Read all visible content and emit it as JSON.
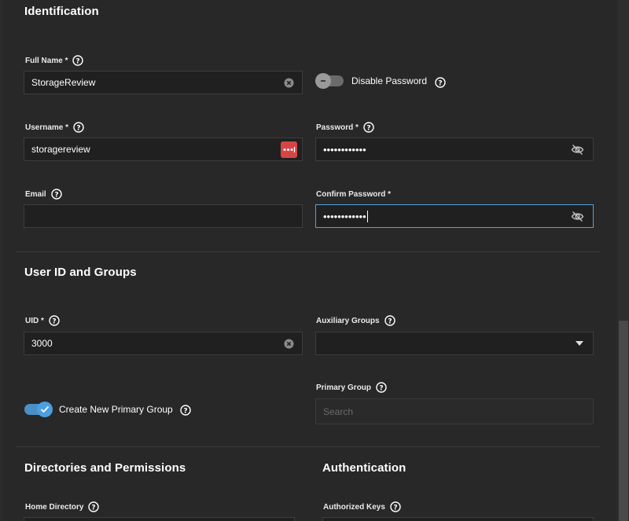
{
  "identification": {
    "title": "Identification",
    "full_name": {
      "label": "Full Name *",
      "value": "StorageReview"
    },
    "disable_password": {
      "label": "Disable Password",
      "checked": false
    },
    "username": {
      "label": "Username *",
      "value": "storagereview"
    },
    "password": {
      "label": "Password *",
      "masked": "••••••••••••"
    },
    "email": {
      "label": "Email",
      "value": ""
    },
    "confirm_password": {
      "label": "Confirm Password *",
      "masked": "••••••••••••"
    }
  },
  "user_id_groups": {
    "title": "User ID and Groups",
    "uid": {
      "label": "UID *",
      "value": "3000"
    },
    "auxiliary_groups": {
      "label": "Auxiliary Groups",
      "value": ""
    },
    "create_primary_group": {
      "label": "Create New Primary Group",
      "checked": true
    },
    "primary_group": {
      "label": "Primary Group",
      "placeholder": "Search"
    }
  },
  "directories": {
    "title": "Directories and Permissions",
    "home_directory": {
      "label": "Home Directory"
    }
  },
  "authentication": {
    "title": "Authentication",
    "authorized_keys": {
      "label": "Authorized Keys"
    }
  },
  "colors": {
    "accent": "#4aa0e0",
    "focus_border": "#5aa0d6",
    "password_manager": "#d64545"
  },
  "icons": [
    "help-circle-icon",
    "clear-circle-icon",
    "eye-off-icon",
    "password-manager-icon",
    "chevron-down-icon",
    "check-icon",
    "minus-icon"
  ]
}
